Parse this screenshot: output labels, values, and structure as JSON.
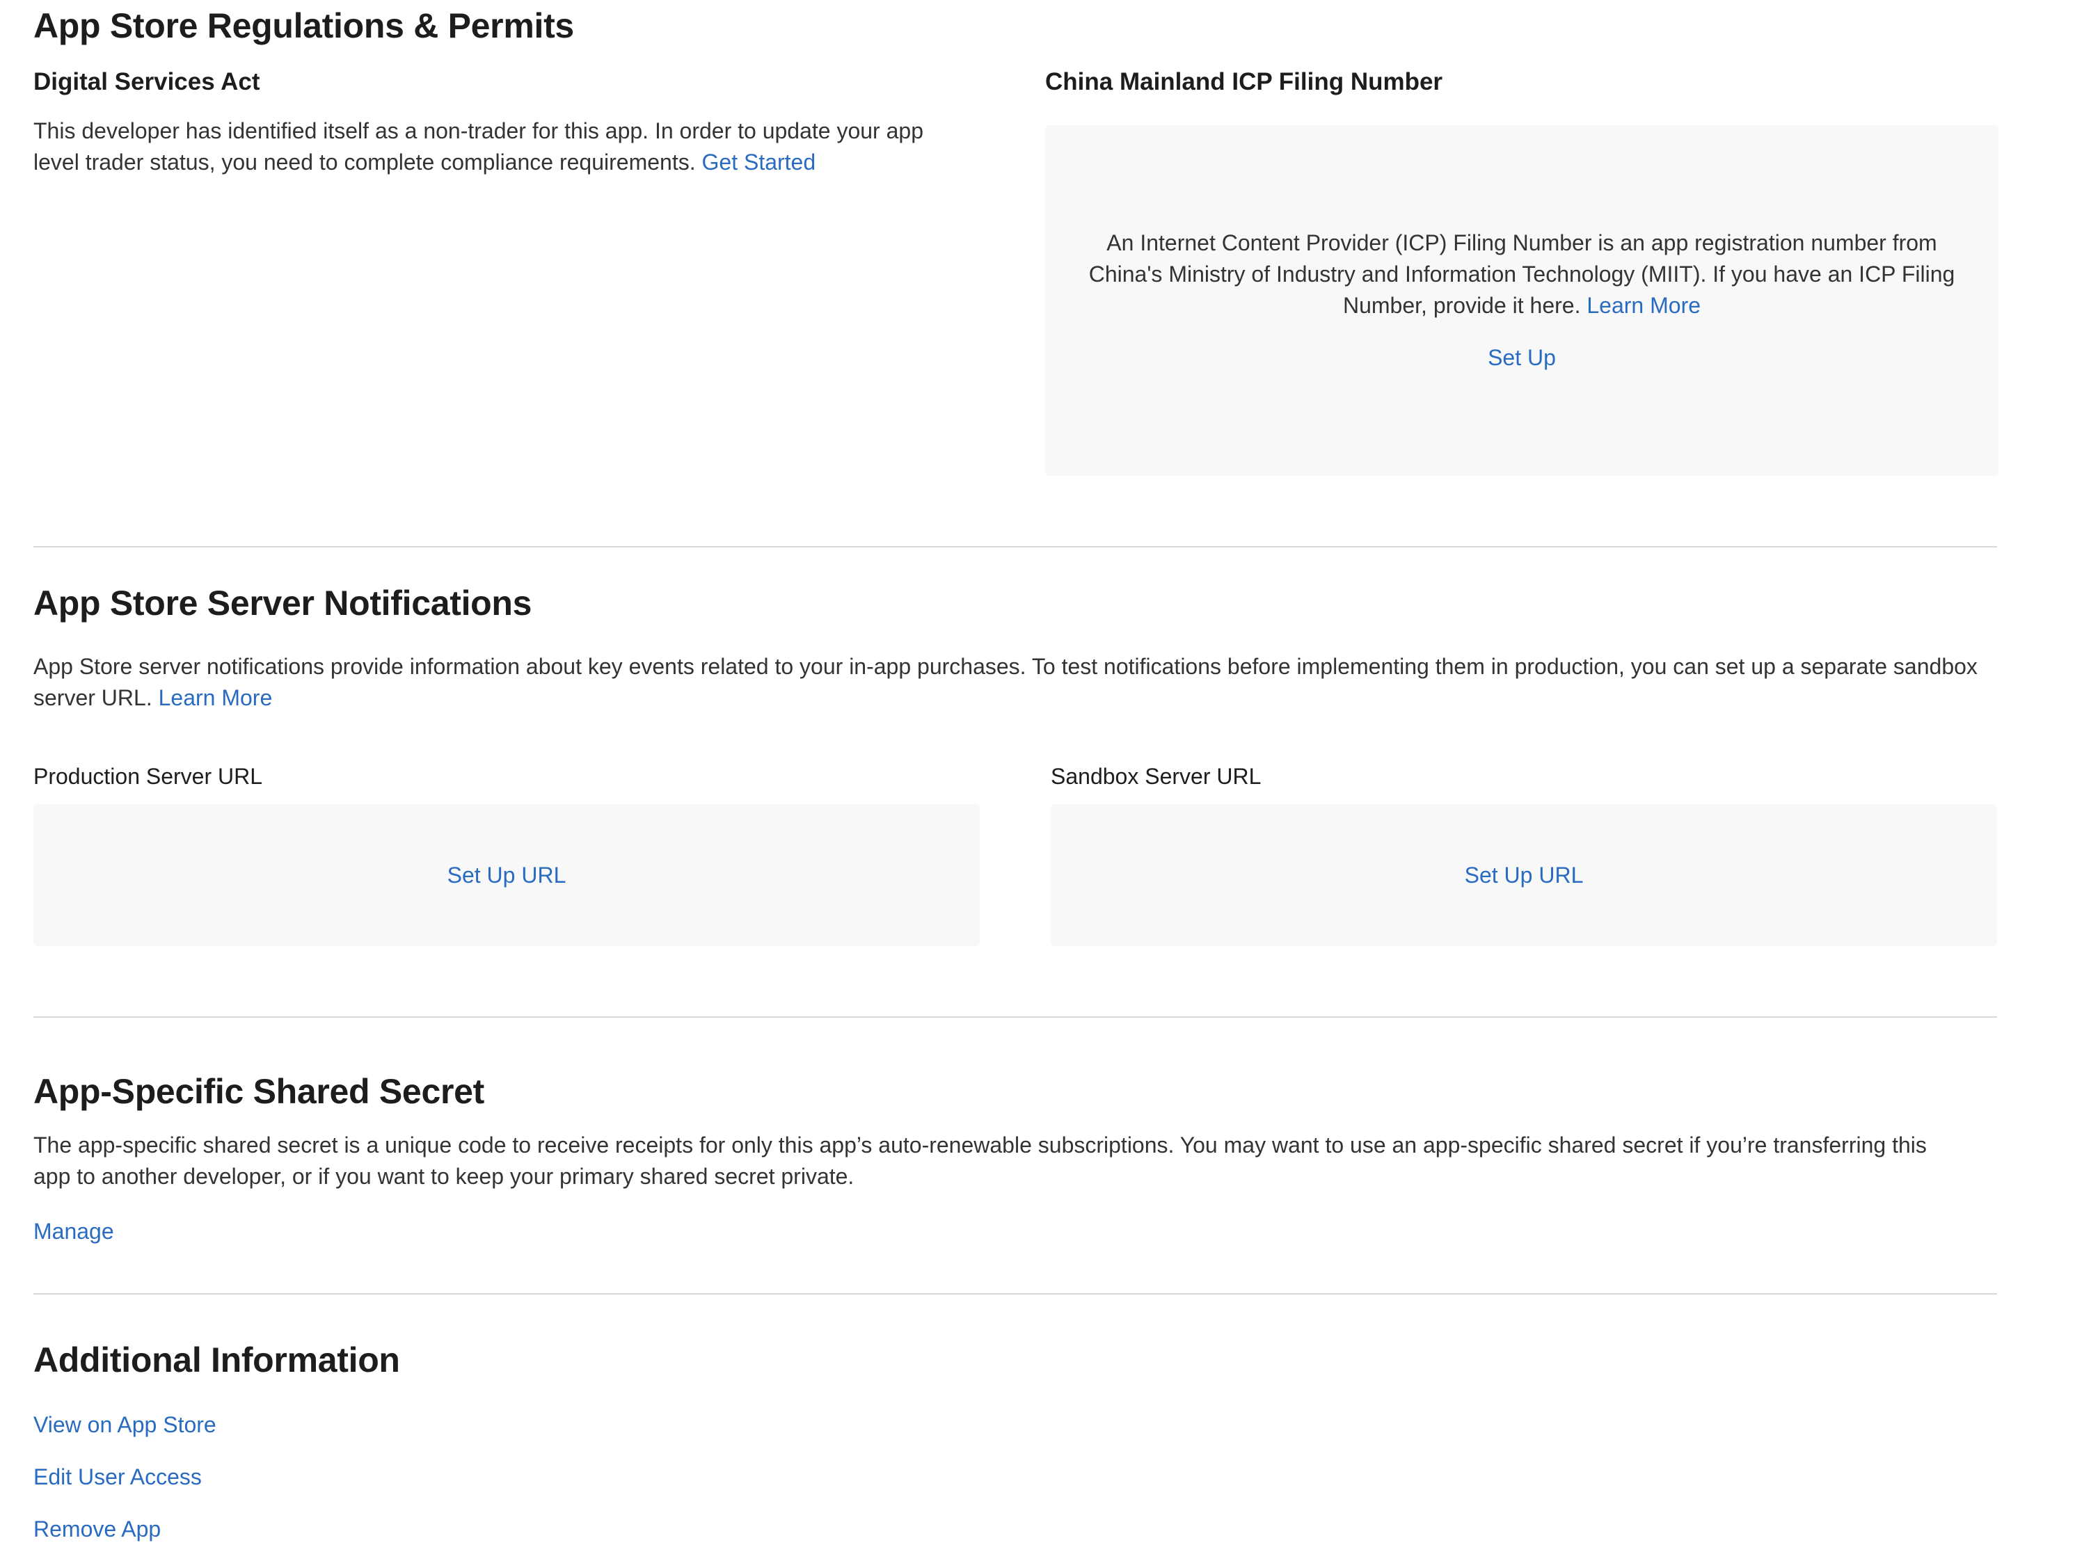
{
  "regulations": {
    "title": "App Store Regulations & Permits",
    "dsa": {
      "heading": "Digital Services Act",
      "text": "This developer has identified itself as a non-trader for this app. In order to update your app level trader status, you need to complete compliance requirements.",
      "link": "Get Started"
    },
    "icp": {
      "heading": "China Mainland ICP Filing Number",
      "text": "An Internet Content Provider (ICP) Filing Number is an app registration number from China's Ministry of Industry and Information Technology (MIIT). If you have an ICP Filing Number, provide it here.",
      "learn_more": "Learn More",
      "setup": "Set Up"
    }
  },
  "notifications": {
    "title": "App Store Server Notifications",
    "text": "App Store server notifications provide information about key events related to your in-app purchases. To test notifications before implementing them in production, you can set up a separate sandbox server URL.",
    "learn_more": "Learn More",
    "production": {
      "label": "Production Server URL",
      "action": "Set Up URL"
    },
    "sandbox": {
      "label": "Sandbox Server URL",
      "action": "Set Up URL"
    }
  },
  "shared_secret": {
    "title": "App-Specific Shared Secret",
    "text": "The app-specific shared secret is a unique code to receive receipts for only this app’s auto-renewable subscriptions. You may want to use an app-specific shared secret if you’re transferring this app to another developer, or if you want to keep your primary shared secret private.",
    "manage": "Manage"
  },
  "additional": {
    "title": "Additional Information",
    "links": [
      "View on App Store",
      "Edit User Access",
      "Remove App"
    ]
  },
  "colors": {
    "link": "#2a6bc2",
    "card_bg": "#f8f8f8",
    "divider": "#d8d8d8"
  }
}
